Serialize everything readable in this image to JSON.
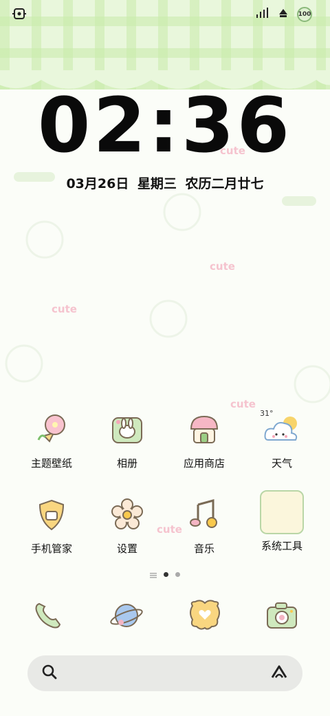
{
  "status_bar": {
    "battery_level": "100"
  },
  "lock": {
    "time": "02:36",
    "date": "03月26日  星期三  农历二月廿七"
  },
  "decorations": {
    "cute_text": "cute"
  },
  "apps_row1": [
    {
      "label": "主题壁纸",
      "icon": "flower-icon"
    },
    {
      "label": "相册",
      "icon": "bunny-photo-icon"
    },
    {
      "label": "应用商店",
      "icon": "mushroom-house-icon"
    },
    {
      "label": "天气",
      "icon": "cloud-sun-icon",
      "temp": "31°"
    }
  ],
  "apps_row2": [
    {
      "label": "手机管家",
      "icon": "shield-icon"
    },
    {
      "label": "设置",
      "icon": "gear-flower-icon"
    },
    {
      "label": "音乐",
      "icon": "music-note-icon"
    },
    {
      "label": "系统工具",
      "icon": "folder-icon"
    }
  ],
  "dock": [
    {
      "icon": "phone-icon"
    },
    {
      "icon": "planet-icon"
    },
    {
      "icon": "heart-bubble-icon"
    },
    {
      "icon": "camera-icon"
    }
  ],
  "page_indicator": {
    "pages": 2,
    "current": 1
  },
  "colors": {
    "plaid": "#e9f7dc",
    "accent_green": "#8bb97a",
    "accent_pink": "#f4b5c4"
  }
}
